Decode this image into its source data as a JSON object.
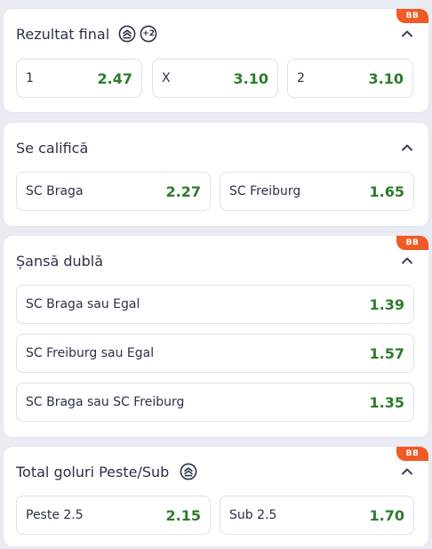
{
  "badge": "BB",
  "markets": [
    {
      "title": "Rezultat final",
      "outcomes": [
        {
          "label": "1",
          "odd": "2.47"
        },
        {
          "label": "X",
          "odd": "3.10"
        },
        {
          "label": "2",
          "odd": "3.10"
        }
      ],
      "extra_count": "+2"
    },
    {
      "title": "Se califică",
      "outcomes": [
        {
          "label": "SC Braga",
          "odd": "2.27"
        },
        {
          "label": "SC Freiburg",
          "odd": "1.65"
        }
      ]
    },
    {
      "title": "Șansă dublă",
      "outcomes": [
        {
          "label": "SC Braga sau Egal",
          "odd": "1.39"
        },
        {
          "label": "SC Freiburg sau Egal",
          "odd": "1.57"
        },
        {
          "label": "SC Braga sau SC Freiburg",
          "odd": "1.35"
        }
      ]
    },
    {
      "title": "Total goluri Peste/Sub",
      "outcomes": [
        {
          "label": "Peste 2.5",
          "odd": "2.15"
        },
        {
          "label": "Sub 2.5",
          "odd": "1.70"
        }
      ]
    }
  ],
  "icons": {
    "betbuilder": "bet-builder-icon",
    "collapse": "chevron-up-icon"
  },
  "colors": {
    "odd": "#2c7d2a",
    "badge": "#f05a24",
    "background": "#e9ecf3"
  }
}
